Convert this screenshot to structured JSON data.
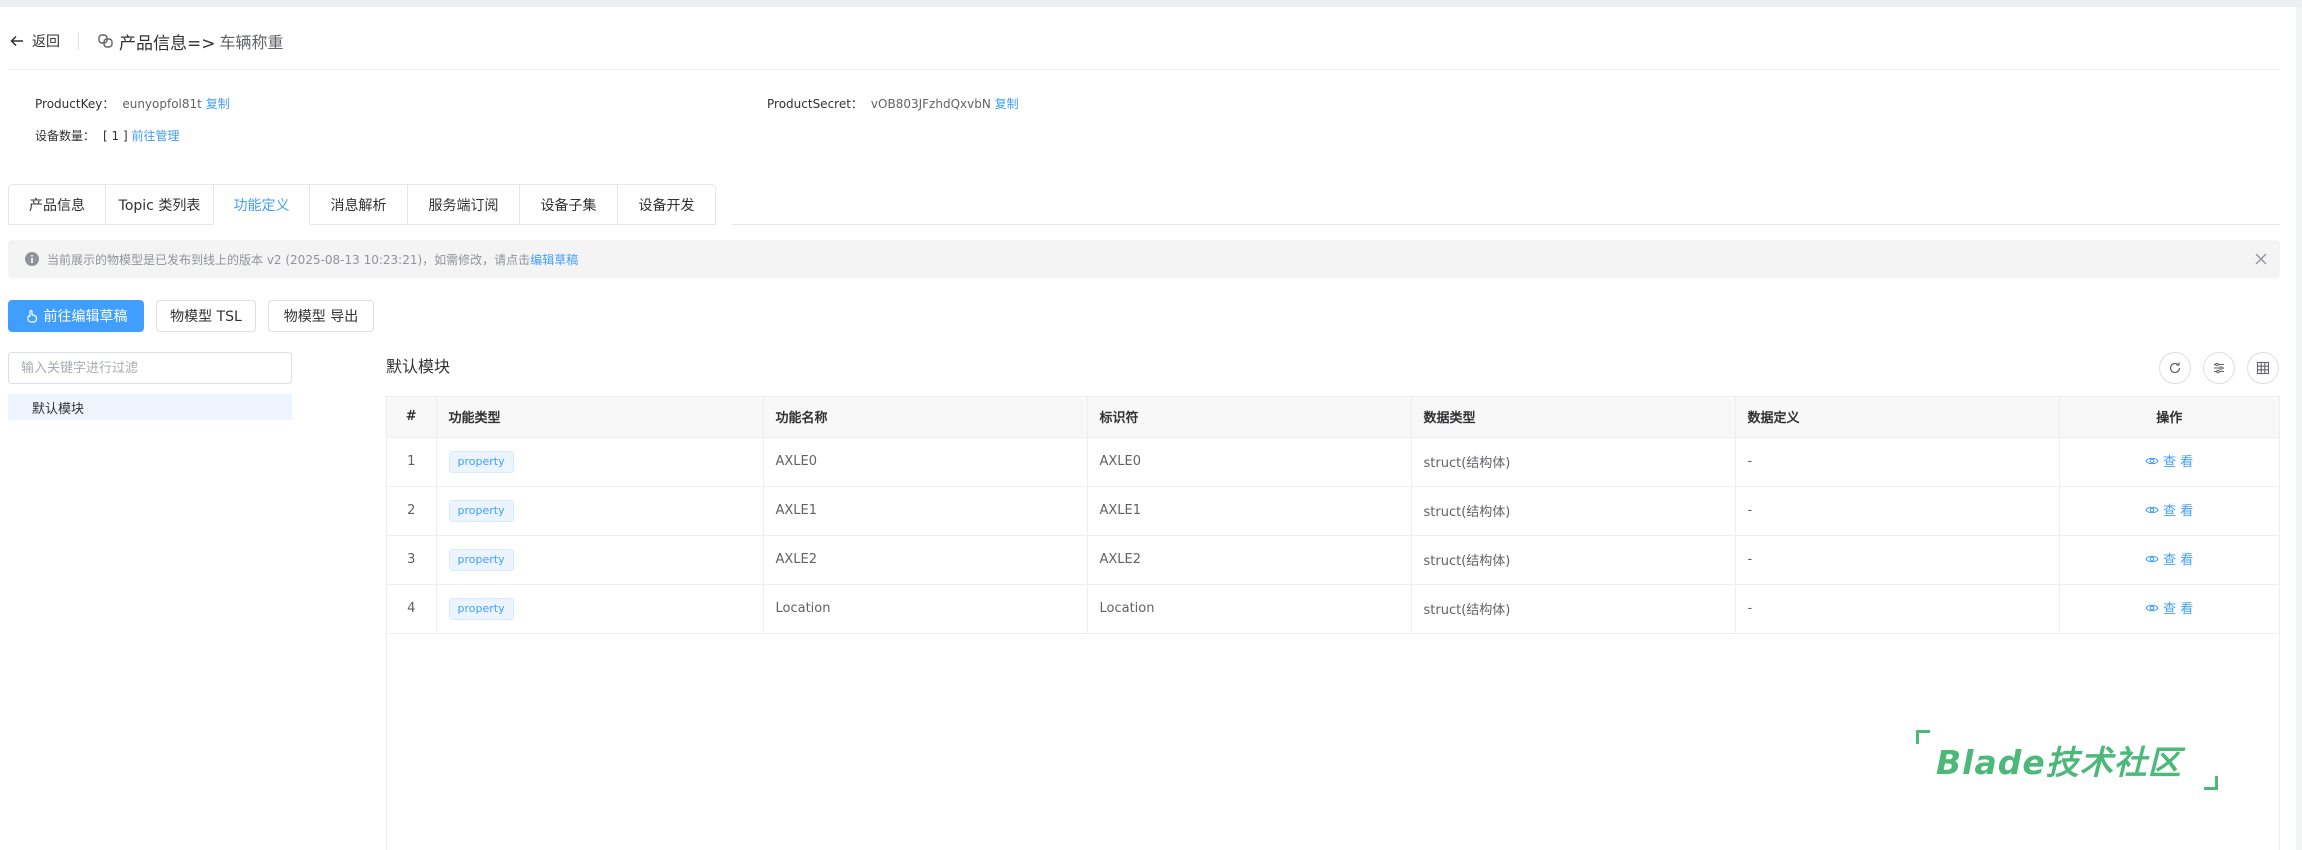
{
  "header": {
    "back_label": "返回",
    "title": "产品信息=>",
    "subtitle": "车辆称重"
  },
  "info": {
    "product_key_label": "ProductKey：",
    "product_key_value": "eunyopfol81t",
    "product_secret_label": "ProductSecret：",
    "product_secret_value": "vOB803JFzhdQxvbN",
    "copy_label": "复制",
    "device_count_label": "设备数量：",
    "device_count_value": "[ 1 ]",
    "manage_link": "前往管理"
  },
  "tabs": [
    {
      "label": "产品信息",
      "active": false
    },
    {
      "label": "Topic 类列表",
      "active": false
    },
    {
      "label": "功能定义",
      "active": true
    },
    {
      "label": "消息解析",
      "active": false
    },
    {
      "label": "服务端订阅",
      "active": false
    },
    {
      "label": "设备子集",
      "active": false
    },
    {
      "label": "设备开发",
      "active": false
    }
  ],
  "alert": {
    "text": "当前展示的物模型是已发布到线上的版本 v2 (2025-08-13 10:23:21)，如需修改，请点击",
    "link": "编辑草稿"
  },
  "actions": {
    "edit_draft": "前往编辑草稿",
    "tsl": "物模型 TSL",
    "export": "物模型 导出"
  },
  "tree": {
    "filter_placeholder": "输入关键字进行过滤",
    "nodes": [
      "默认模块"
    ]
  },
  "module": {
    "title": "默认模块"
  },
  "table": {
    "columns": [
      "#",
      "功能类型",
      "功能名称",
      "标识符",
      "数据类型",
      "数据定义",
      "操作"
    ],
    "rows": [
      {
        "index": "1",
        "type": "property",
        "name": "AXLE0",
        "identifier": "AXLE0",
        "data_type": "struct(结构体)",
        "definition": "-",
        "action": "查 看"
      },
      {
        "index": "2",
        "type": "property",
        "name": "AXLE1",
        "identifier": "AXLE1",
        "data_type": "struct(结构体)",
        "definition": "-",
        "action": "查 看"
      },
      {
        "index": "3",
        "type": "property",
        "name": "AXLE2",
        "identifier": "AXLE2",
        "data_type": "struct(结构体)",
        "definition": "-",
        "action": "查 看"
      },
      {
        "index": "4",
        "type": "property",
        "name": "Location",
        "identifier": "Location",
        "data_type": "struct(结构体)",
        "definition": "-",
        "action": "查 看"
      }
    ]
  },
  "watermark": {
    "text": "Blade技术社区"
  },
  "icons": {
    "back": "arrow-left-icon",
    "product": "link-icon",
    "info": "info-circle-icon",
    "close": "close-icon",
    "edit": "hand-pointer-icon",
    "refresh": "refresh-icon",
    "filter": "sliders-icon",
    "columns": "grid-icon",
    "view": "eye-icon"
  },
  "colors": {
    "primary": "#409eff",
    "watermark": "#4cb87a"
  }
}
